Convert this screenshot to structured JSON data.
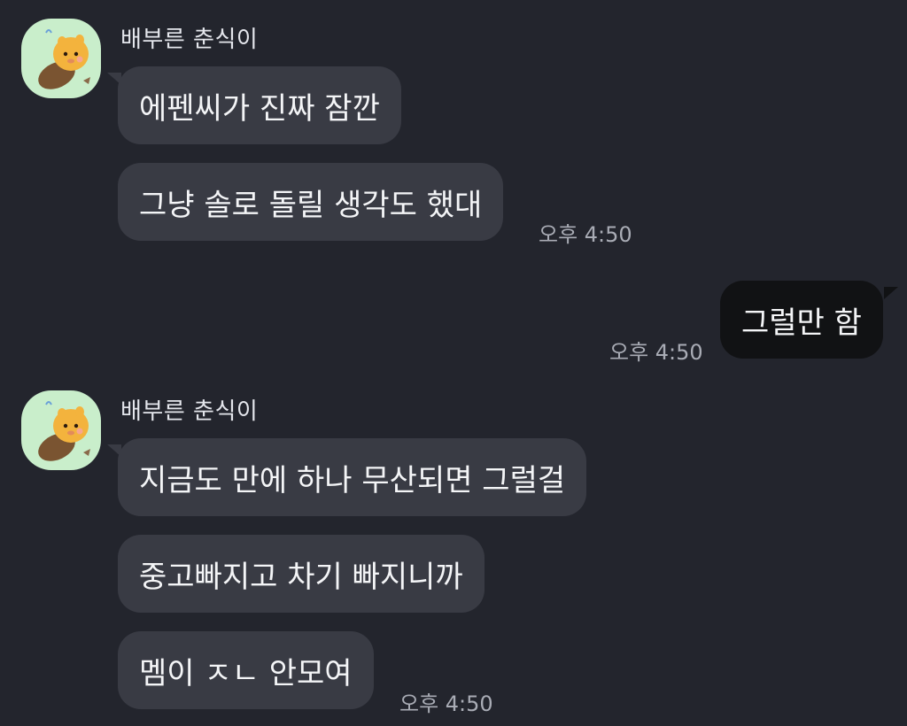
{
  "chat": {
    "groups": [
      {
        "sender": "배부른 춘식이",
        "avatar_icon": "chunsik-character-icon",
        "messages": [
          "에펜씨가 진짜 잠깐",
          "그냥 솔로 돌릴 생각도 했대"
        ],
        "time": "오후 4:50"
      },
      {
        "sender": "me",
        "messages": [
          "그럴만 함"
        ],
        "time": "오후 4:50"
      },
      {
        "sender": "배부른 춘식이",
        "avatar_icon": "chunsik-character-icon",
        "messages": [
          "지금도 만에 하나 무산되면 그럴걸",
          "중고빠지고 차기 빠지니까",
          "멤이 ㅈㄴ 안모여"
        ],
        "time": "오후 4:50"
      }
    ]
  },
  "colors": {
    "background": "#23252d",
    "incoming_bubble": "#393b44",
    "outgoing_bubble": "#111214",
    "avatar_background": "#c9eecb"
  }
}
